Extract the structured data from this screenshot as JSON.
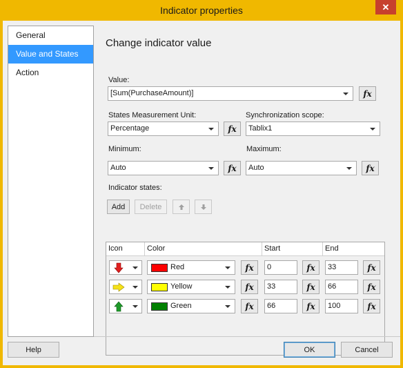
{
  "window": {
    "title": "Indicator properties",
    "close_glyph": "✕"
  },
  "nav": {
    "items": [
      {
        "label": "General",
        "selected": false
      },
      {
        "label": "Value and States",
        "selected": true
      },
      {
        "label": "Action",
        "selected": false
      }
    ]
  },
  "page": {
    "heading": "Change indicator value",
    "value_label": "Value:",
    "value": "[Sum(PurchaseAmount)]",
    "units_label": "States Measurement Unit:",
    "units_value": "Percentage",
    "sync_label": "Synchronization scope:",
    "sync_value": "Tablix1",
    "min_label": "Minimum:",
    "min_value": "Auto",
    "max_label": "Maximum:",
    "max_value": "Auto",
    "states_label": "Indicator states:",
    "fx_label": "fx"
  },
  "toolbar": {
    "add_label": "Add",
    "delete_label": "Delete"
  },
  "grid": {
    "headers": {
      "icon": "Icon",
      "color": "Color",
      "start": "Start",
      "end": "End"
    },
    "rows": [
      {
        "icon": "arrow-down-red-icon",
        "color_name": "Red",
        "color_hex": "#ff0000",
        "start": "0",
        "end": "33"
      },
      {
        "icon": "arrow-right-yellow-icon",
        "color_name": "Yellow",
        "color_hex": "#ffff00",
        "start": "33",
        "end": "66"
      },
      {
        "icon": "arrow-up-green-icon",
        "color_name": "Green",
        "color_hex": "#008000",
        "start": "66",
        "end": "100"
      }
    ]
  },
  "footer": {
    "help_label": "Help",
    "ok_label": "OK",
    "cancel_label": "Cancel"
  },
  "colors": {
    "title_bar": "#f0b800",
    "selection": "#3399ff",
    "close": "#c7402d"
  }
}
